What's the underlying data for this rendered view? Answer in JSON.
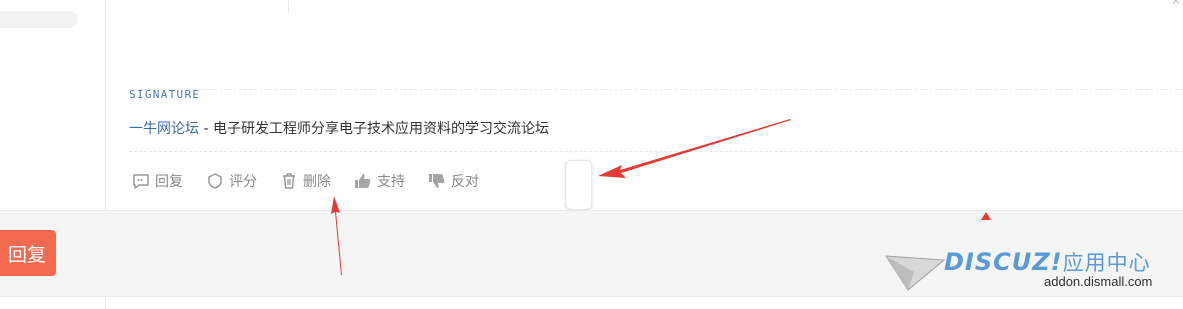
{
  "signature": {
    "heading": "SIGNATURE",
    "link_text": "一牛网论坛",
    "separator": " - ",
    "description": "电子研发工程师分享电子技术应用资料的学习交流论坛"
  },
  "actions": [
    {
      "name": "reply-action",
      "icon": "comment-icon",
      "label": "回复"
    },
    {
      "name": "rate-action",
      "icon": "badge-icon",
      "label": "评分"
    },
    {
      "name": "delete-action",
      "icon": "trash-icon",
      "label": "删除"
    },
    {
      "name": "support-action",
      "icon": "thumbs-up-icon",
      "label": "支持"
    },
    {
      "name": "oppose-action",
      "icon": "thumbs-down-icon",
      "label": "反对"
    }
  ],
  "footer": {
    "reply_button_label": "回复"
  },
  "watermark": {
    "brand": "DISCUZ!",
    "brand_cn": "应用中心",
    "domain": "addon.dismall.com"
  },
  "colors": {
    "accent_red": "#e53935",
    "reply_button": "#f26b51",
    "link_blue": "#3b6ea8",
    "action_gray": "#8a8a8a"
  }
}
